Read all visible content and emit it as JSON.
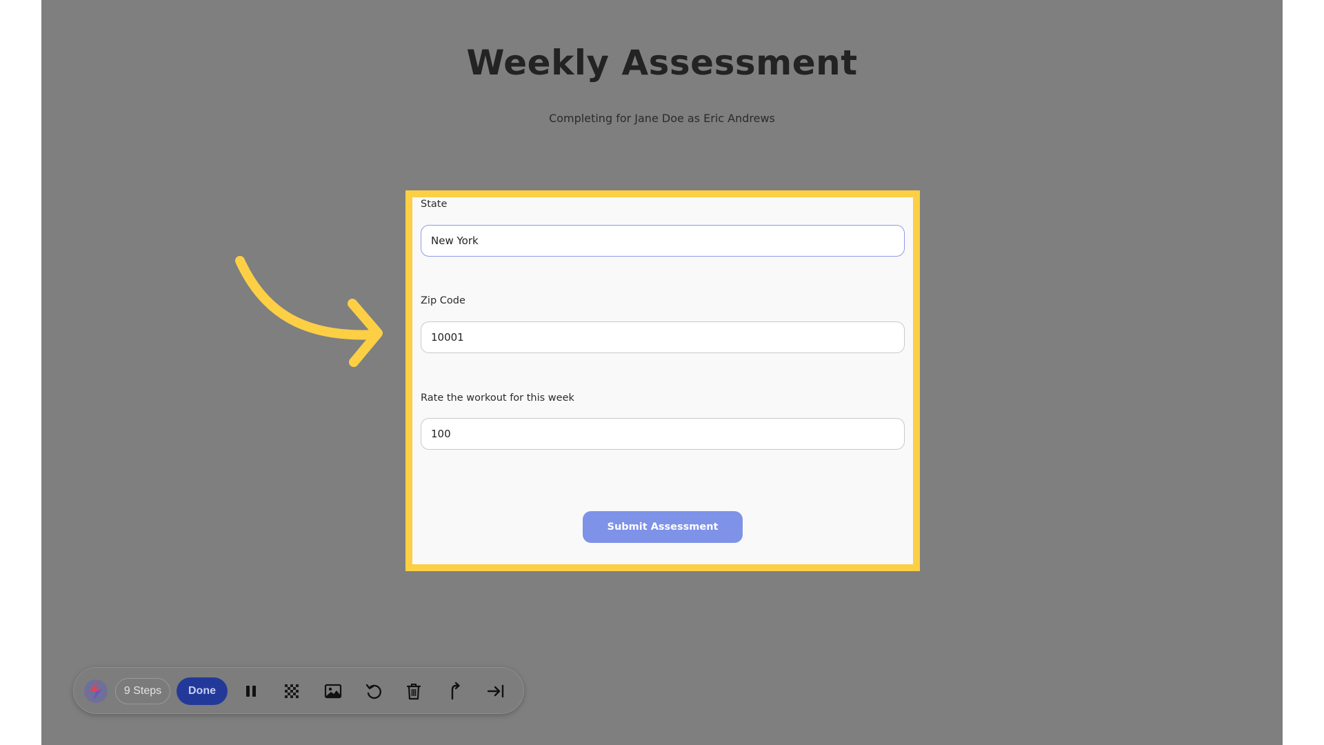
{
  "page": {
    "title": "Weekly Assessment",
    "subtitle": "Completing for Jane Doe as Eric Andrews"
  },
  "form": {
    "fields": [
      {
        "label": "State",
        "value": "New York",
        "focused": true
      },
      {
        "label": "Zip Code",
        "value": "10001",
        "focused": false
      },
      {
        "label": "Rate the workout for this week",
        "value": "100",
        "focused": false
      }
    ],
    "submit_label": "Submit Assessment"
  },
  "toolbar": {
    "steps_label": "9 Steps",
    "done_label": "Done",
    "icons": [
      "logo-icon",
      "pause-icon",
      "blur-icon",
      "image-icon",
      "undo-icon",
      "trash-icon",
      "branch-icon",
      "skip-to-end-icon"
    ]
  },
  "colors": {
    "backdrop": "#7f7f7f",
    "highlight": "#fdcf45",
    "submit": "#7e92e8",
    "done": "#23399a"
  }
}
